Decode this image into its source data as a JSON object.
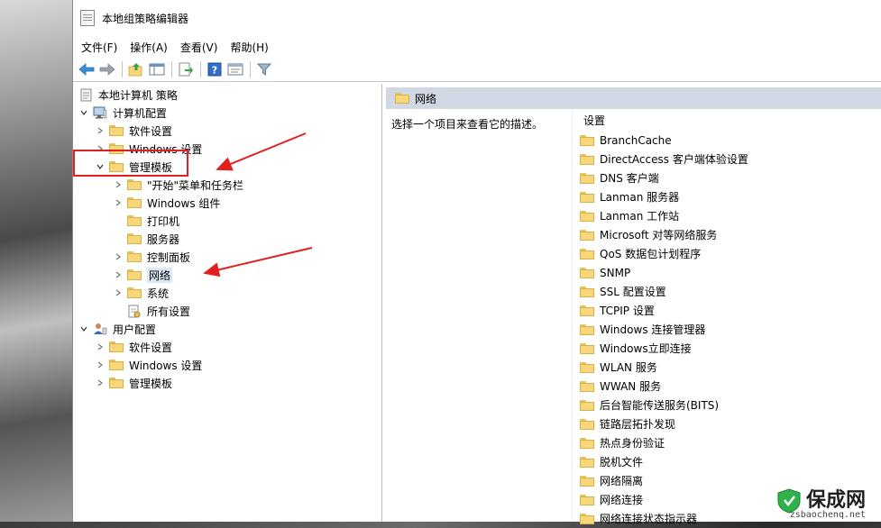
{
  "window": {
    "title": "本地组策略编辑器"
  },
  "menu": [
    "文件(F)",
    "操作(A)",
    "查看(V)",
    "帮助(H)"
  ],
  "toolbar": [
    "back-icon",
    "forward-icon",
    "up-folder-icon",
    "show-hide-tree-icon",
    "export-list-icon",
    "help-icon",
    "properties-icon",
    "filter-icon"
  ],
  "tree": {
    "root": "本地计算机 策略",
    "computer_config": "计算机配置",
    "software_settings": "软件设置",
    "windows_settings": "Windows 设置",
    "admin_templates": "管理模板",
    "admin_children": [
      "\"开始\"菜单和任务栏",
      "Windows 组件",
      "打印机",
      "服务器",
      "控制面板",
      "网络",
      "系统",
      "所有设置"
    ],
    "user_config": "用户配置",
    "user_children": [
      "软件设置",
      "Windows 设置",
      "管理模板"
    ]
  },
  "right_pane": {
    "header": "网络",
    "description": "选择一个项目来查看它的描述。",
    "column_header": "设置",
    "items": [
      "BranchCache",
      "DirectAccess 客户端体验设置",
      "DNS 客户端",
      "Lanman 服务器",
      "Lanman 工作站",
      "Microsoft 对等网络服务",
      "QoS 数据包计划程序",
      "SNMP",
      "SSL 配置设置",
      "TCPIP 设置",
      "Windows 连接管理器",
      "Windows立即连接",
      "WLAN 服务",
      "WWAN 服务",
      "后台智能传送服务(BITS)",
      "链路层拓扑发现",
      "热点身份验证",
      "脱机文件",
      "网络隔离",
      "网络连接",
      "网络连接状态指示器"
    ]
  },
  "watermark": {
    "text": "保成网",
    "url": "zsbaochenq.net"
  },
  "colors": {
    "annotation_red": "#e02020",
    "header_bg": "#cfd8e3",
    "folder": "#f7d77a"
  }
}
